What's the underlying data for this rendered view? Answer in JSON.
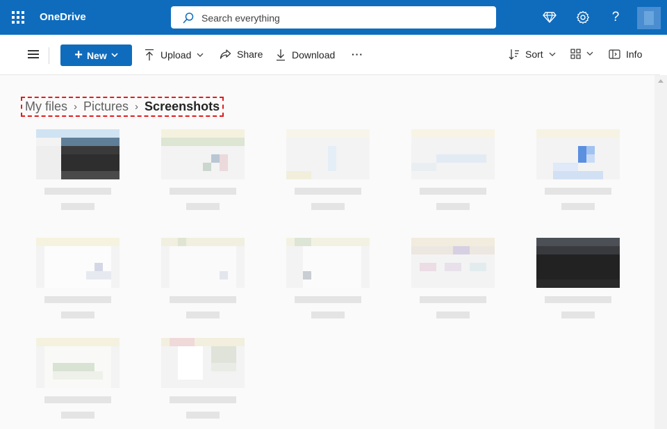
{
  "app": {
    "name": "OneDrive"
  },
  "search": {
    "placeholder": "Search everything"
  },
  "toolbar": {
    "new_label": "New",
    "upload_label": "Upload",
    "share_label": "Share",
    "download_label": "Download",
    "more_label": "···",
    "sort_label": "Sort",
    "info_label": "Info"
  },
  "breadcrumb": [
    {
      "label": "My files"
    },
    {
      "label": "Pictures"
    },
    {
      "label": "Screenshots"
    }
  ],
  "breadcrumb_separator": "›",
  "icons": {
    "app_launcher": "waffle-icon",
    "premium": "diamond-icon",
    "settings": "gear-icon",
    "help": "question-icon",
    "help_glyph": "?",
    "settings_glyph": "⚙",
    "premium_glyph": "◇"
  },
  "colors": {
    "brand": "#0f6cbd",
    "highlight_border": "#e21b1b"
  }
}
